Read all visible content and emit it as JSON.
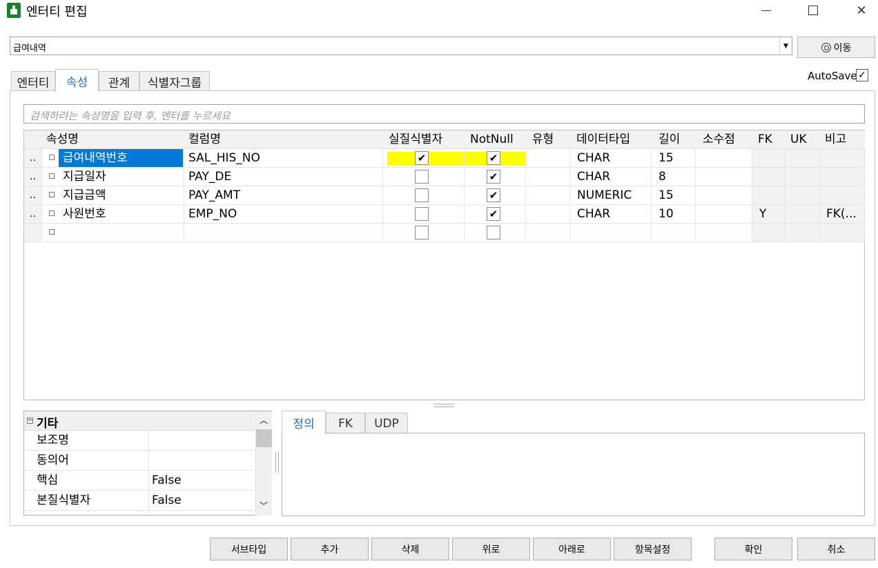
{
  "window": {
    "title": "엔터티 편집"
  },
  "entity_select": {
    "value": "급여내역"
  },
  "move_button": {
    "label": "이동"
  },
  "tabs": [
    "엔터티",
    "속성",
    "관계",
    "식별자그룹"
  ],
  "autosave": {
    "label": "AutoSave",
    "checked": true
  },
  "search": {
    "placeholder": "검색하려는 속성명을 입력 후, 엔터를 누르세요"
  },
  "grid": {
    "headers": [
      "속성명",
      "컬럼명",
      "실질식별자",
      "NotNull",
      "유형",
      "데이터타입",
      "길이",
      "소수점",
      "FK",
      "UK",
      "비고"
    ],
    "rows": [
      {
        "marker": "..",
        "name": "급여내역번호",
        "column": "SAL_HIS_NO",
        "pk": true,
        "notnull": true,
        "type": "",
        "datatype": "CHAR",
        "length": "15",
        "scale": "",
        "fk": "",
        "uk": "",
        "note": ""
      },
      {
        "marker": "..",
        "name": "지급일자",
        "column": "PAY_DE",
        "pk": false,
        "notnull": true,
        "type": "",
        "datatype": "CHAR",
        "length": "8",
        "scale": "",
        "fk": "",
        "uk": "",
        "note": ""
      },
      {
        "marker": "..",
        "name": "지급금액",
        "column": "PAY_AMT",
        "pk": false,
        "notnull": true,
        "type": "",
        "datatype": "NUMERIC",
        "length": "15",
        "scale": "",
        "fk": "",
        "uk": "",
        "note": ""
      },
      {
        "marker": "..",
        "name": "사원번호",
        "column": "EMP_NO",
        "pk": false,
        "notnull": true,
        "type": "",
        "datatype": "CHAR",
        "length": "10",
        "scale": "",
        "fk": "Y",
        "uk": "",
        "note": "FK(..."
      },
      {
        "marker": "",
        "name": "",
        "column": "",
        "pk": false,
        "notnull": false,
        "type": "",
        "datatype": "",
        "length": "",
        "scale": "",
        "fk": "",
        "uk": "",
        "note": ""
      }
    ]
  },
  "props": {
    "section": "기타",
    "rows": [
      {
        "label": "보조명",
        "value": ""
      },
      {
        "label": "동의어",
        "value": ""
      },
      {
        "label": "핵심",
        "value": "False"
      },
      {
        "label": "본질식별자",
        "value": "False"
      }
    ]
  },
  "detail_tabs": [
    "정의",
    "FK",
    "UDP"
  ],
  "buttons": [
    "서브타입",
    "추가",
    "삭제",
    "위로",
    "아래로",
    "항목설정",
    "확인",
    "취소"
  ],
  "colors": {
    "accent": "#2272c9",
    "highlight": "#ffff00",
    "selection": "#0078d7"
  }
}
